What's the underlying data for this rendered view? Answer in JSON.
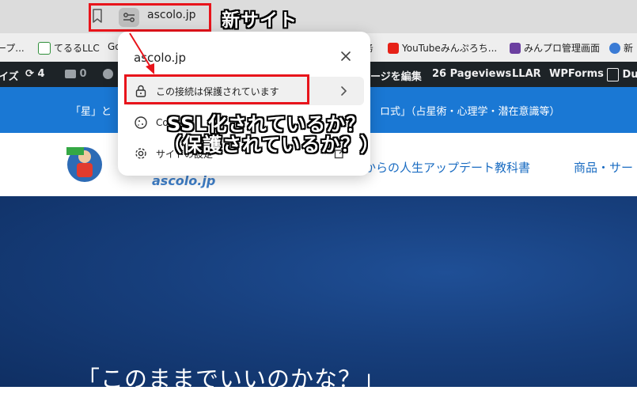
{
  "browser": {
    "url": "ascolo.jp",
    "annotation_new_site": "新サイト"
  },
  "bookmarks": [
    {
      "label": "ープ...",
      "color": "#888888"
    },
    {
      "label": "てるるLLC",
      "color": "#2f8f3a"
    },
    {
      "label": "Go",
      "color": "#4285f4"
    },
    {
      "label": "务",
      "color": "#888888"
    },
    {
      "label": "YouTubeみんぷろち...",
      "color": "#e62117"
    },
    {
      "label": "みんプロ管理画面",
      "color": "#6b3fa0"
    },
    {
      "label": "新",
      "color": "#3a7bd5"
    }
  ],
  "admin_bar": {
    "item_customize": "イズ",
    "updates_count": "4",
    "comments_count": "0",
    "edit_page": "ージを編集",
    "pageviews": "26 Pageviews",
    "llar": "LLAR",
    "wpforms": "WPForms",
    "duplicate": "Du"
  },
  "site_header": {
    "left_text": "「星」と",
    "right_text": "ロ式」（占星術・心理学・潜在意識等）"
  },
  "site_nav": {
    "logo_sub": "ascolo.jp",
    "tagline": "からの人生アップデート教科書",
    "menu_item": "商品・サー"
  },
  "hero": {
    "text": "「このままでいいのかな？」"
  },
  "popup": {
    "title": "ascolo.jp",
    "connection_label": "この接続は保護されています",
    "cookie_label": "Co",
    "settings_label": "サイトの設定"
  },
  "annotation": {
    "line1": "SSL化されているか？",
    "line2": "（保護されているか？）"
  },
  "colors": {
    "highlight": "#e8141b",
    "blue_header": "#1a78d4",
    "admin_bar": "#1d2327"
  }
}
